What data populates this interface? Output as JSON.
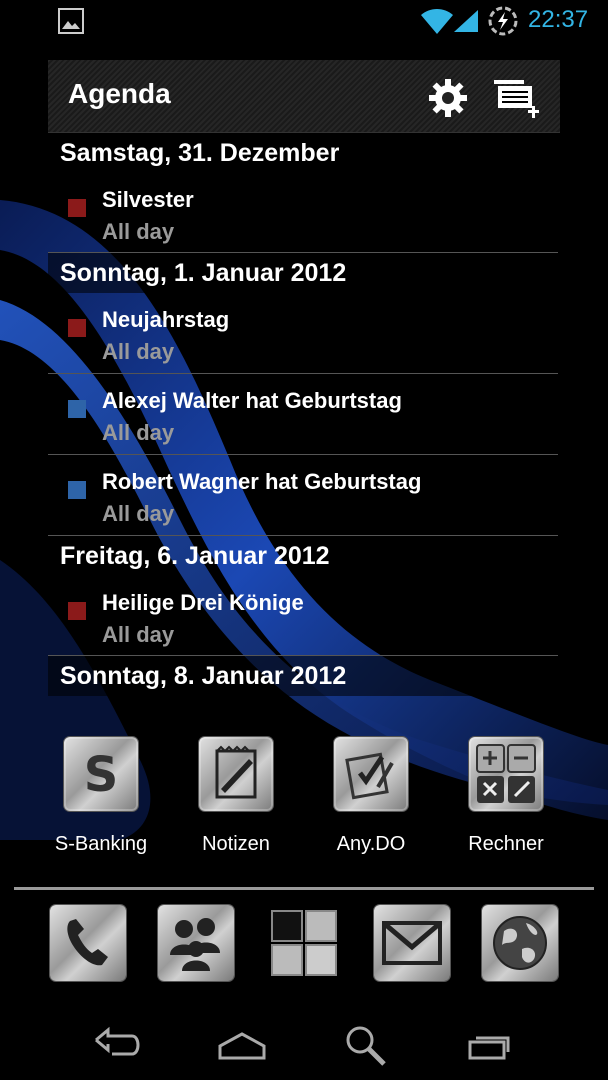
{
  "status_bar": {
    "time": "22:37",
    "icons": [
      "image-icon",
      "wifi-icon",
      "signal-icon",
      "sync-icon"
    ],
    "time_color": "#33b5e5"
  },
  "agenda": {
    "title": "Agenda",
    "header_icons": [
      "gear-icon",
      "new-event-icon"
    ],
    "days": [
      {
        "label": "Samstag, 31. Dezember",
        "events": [
          {
            "title": "Silvester",
            "subtitle": "All day",
            "color": "#8b1a1a"
          }
        ]
      },
      {
        "label": "Sonntag, 1. Januar 2012",
        "events": [
          {
            "title": "Neujahrstag",
            "subtitle": "All day",
            "color": "#8b1a1a"
          },
          {
            "title": "Alexej Walter hat Geburtstag",
            "subtitle": "All day",
            "color": "#2e64a8"
          },
          {
            "title": "Robert Wagner hat Geburtstag",
            "subtitle": "All day",
            "color": "#2e64a8"
          }
        ]
      },
      {
        "label": "Freitag, 6. Januar 2012",
        "events": [
          {
            "title": "Heilige Drei Könige",
            "subtitle": "All day",
            "color": "#8b1a1a"
          }
        ]
      },
      {
        "label": "Sonntag, 8. Januar 2012",
        "events": []
      }
    ]
  },
  "apps": [
    {
      "label": "S-Banking",
      "icon": "s-banking-icon"
    },
    {
      "label": "Notizen",
      "icon": "notepad-icon"
    },
    {
      "label": "Any.DO",
      "icon": "checklist-icon"
    },
    {
      "label": "Rechner",
      "icon": "calculator-icon"
    }
  ],
  "dock": [
    "phone-icon",
    "contacts-icon",
    "app-drawer-icon",
    "gmail-icon",
    "browser-icon"
  ],
  "nav": [
    "back-icon",
    "home-icon",
    "search-icon",
    "recent-apps-icon"
  ]
}
